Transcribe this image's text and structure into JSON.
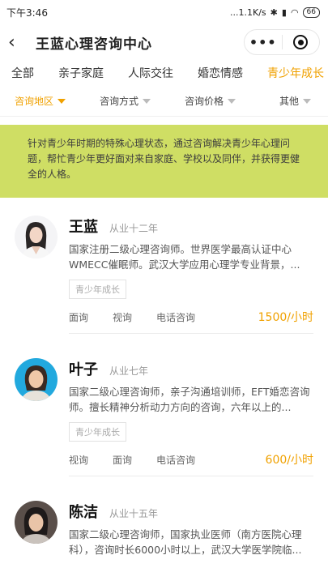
{
  "status_bar": {
    "time": "下午3:46",
    "speed": "...1.1K/s",
    "battery": "66"
  },
  "nav": {
    "title": "王蓝心理咨询中心",
    "more": "•••"
  },
  "categories": [
    "全部",
    "亲子家庭",
    "人际交往",
    "婚恋情感",
    "青少年成长"
  ],
  "filters": [
    "咨询地区",
    "咨询方式",
    "咨询价格",
    "其他"
  ],
  "banner": "针对青少年时期的特殊心理状态，通过咨询解决青少年心理问题，帮忙青少年更好面对来自家庭、学校以及同伴，并获得更健全的人格。",
  "counselors": [
    {
      "name": "王蓝",
      "years": "从业十二年",
      "desc": "国家注册二级心理咨询师。世界医学最高认证中心WMECC催眠师。武汉大学应用心理学专业背景，...",
      "tag": "青少年成长",
      "methods": [
        "面询",
        "视询",
        "电话咨询"
      ],
      "price": "1500/小时"
    },
    {
      "name": "叶子",
      "years": "从业七年",
      "desc": "国家二级心理咨询师，亲子沟通培训师，EFT婚恋咨询师。擅长精神分析动力方向的咨询，六年以上的...",
      "tag": "青少年成长",
      "methods": [
        "视询",
        "面询",
        "电话咨询"
      ],
      "price": "600/小时"
    },
    {
      "name": "陈洁",
      "years": "从业十五年",
      "desc": "国家二级心理咨询师，国家执业医师（南方医院心理科），咨询时长6000小时以上，武汉大学医学院临..."
    }
  ],
  "colors": {
    "accent": "#f0a100",
    "banner_bg": "#cfde64"
  }
}
